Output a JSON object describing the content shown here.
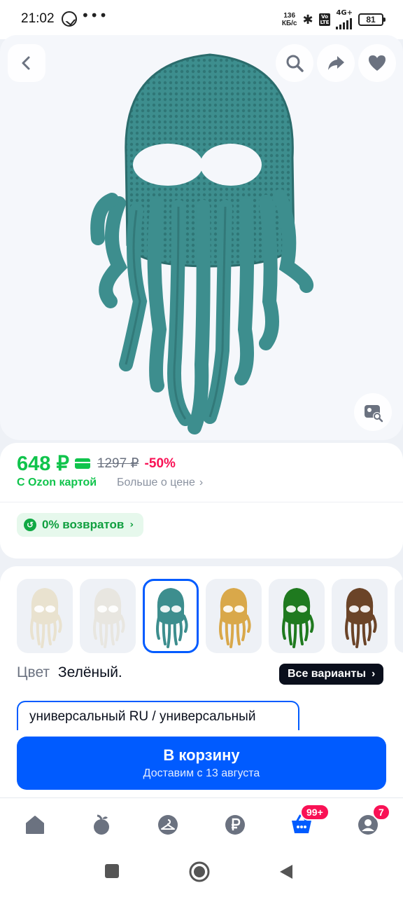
{
  "status_bar": {
    "time": "21:02",
    "net_speed_value": "136",
    "net_speed_unit": "КБ/с",
    "volte_top": "Vo",
    "volte_bottom": "LTE",
    "network": "4G+",
    "battery": "81"
  },
  "image_area": {
    "icons": {
      "back": "chevron-left-icon",
      "search": "search-icon",
      "share": "share-icon",
      "favorite": "heart-icon",
      "visual_search": "visual-search-icon"
    }
  },
  "pricing": {
    "price": "648 ₽",
    "old_price": "1297 ₽",
    "discount": "-50%",
    "ozon_card_label": "С Ozon картой",
    "more_price_label": "Больше о цене",
    "returns_label": "0% возвратов"
  },
  "variants": {
    "thumbnails": [
      {
        "name": "white-variant",
        "color": "#e9e2cf",
        "selected": false
      },
      {
        "name": "light-grey-variant",
        "color": "#e8e6e0",
        "selected": false
      },
      {
        "name": "teal-variant",
        "color": "#3d8e8e",
        "selected": true
      },
      {
        "name": "yellow-variant",
        "color": "#d9a84a",
        "selected": false
      },
      {
        "name": "green-variant",
        "color": "#1f7a1f",
        "selected": false
      },
      {
        "name": "brown-variant",
        "color": "#6b4428",
        "selected": false
      }
    ],
    "color_label": "Цвет",
    "color_value": "Зелёный.",
    "all_variants_label": "Все варианты",
    "size_value": "универсальный RU / универсальный"
  },
  "cart": {
    "title": "В корзину",
    "subtitle": "Доставим с 13 августа"
  },
  "bottom_nav": {
    "items": [
      {
        "name": "home",
        "icon": "home-icon"
      },
      {
        "name": "fresh",
        "icon": "fresh-apple-icon"
      },
      {
        "name": "catalog",
        "icon": "hanger-icon"
      },
      {
        "name": "finance",
        "icon": "ruble-icon"
      },
      {
        "name": "cart",
        "icon": "cart-icon",
        "badge": "99+"
      },
      {
        "name": "profile",
        "icon": "profile-icon",
        "badge": "7"
      }
    ]
  },
  "colors": {
    "brand_blue": "#005bff",
    "price_green": "#10c44c",
    "discount_pink": "#f91155",
    "product_teal": "#3d8e8e"
  }
}
